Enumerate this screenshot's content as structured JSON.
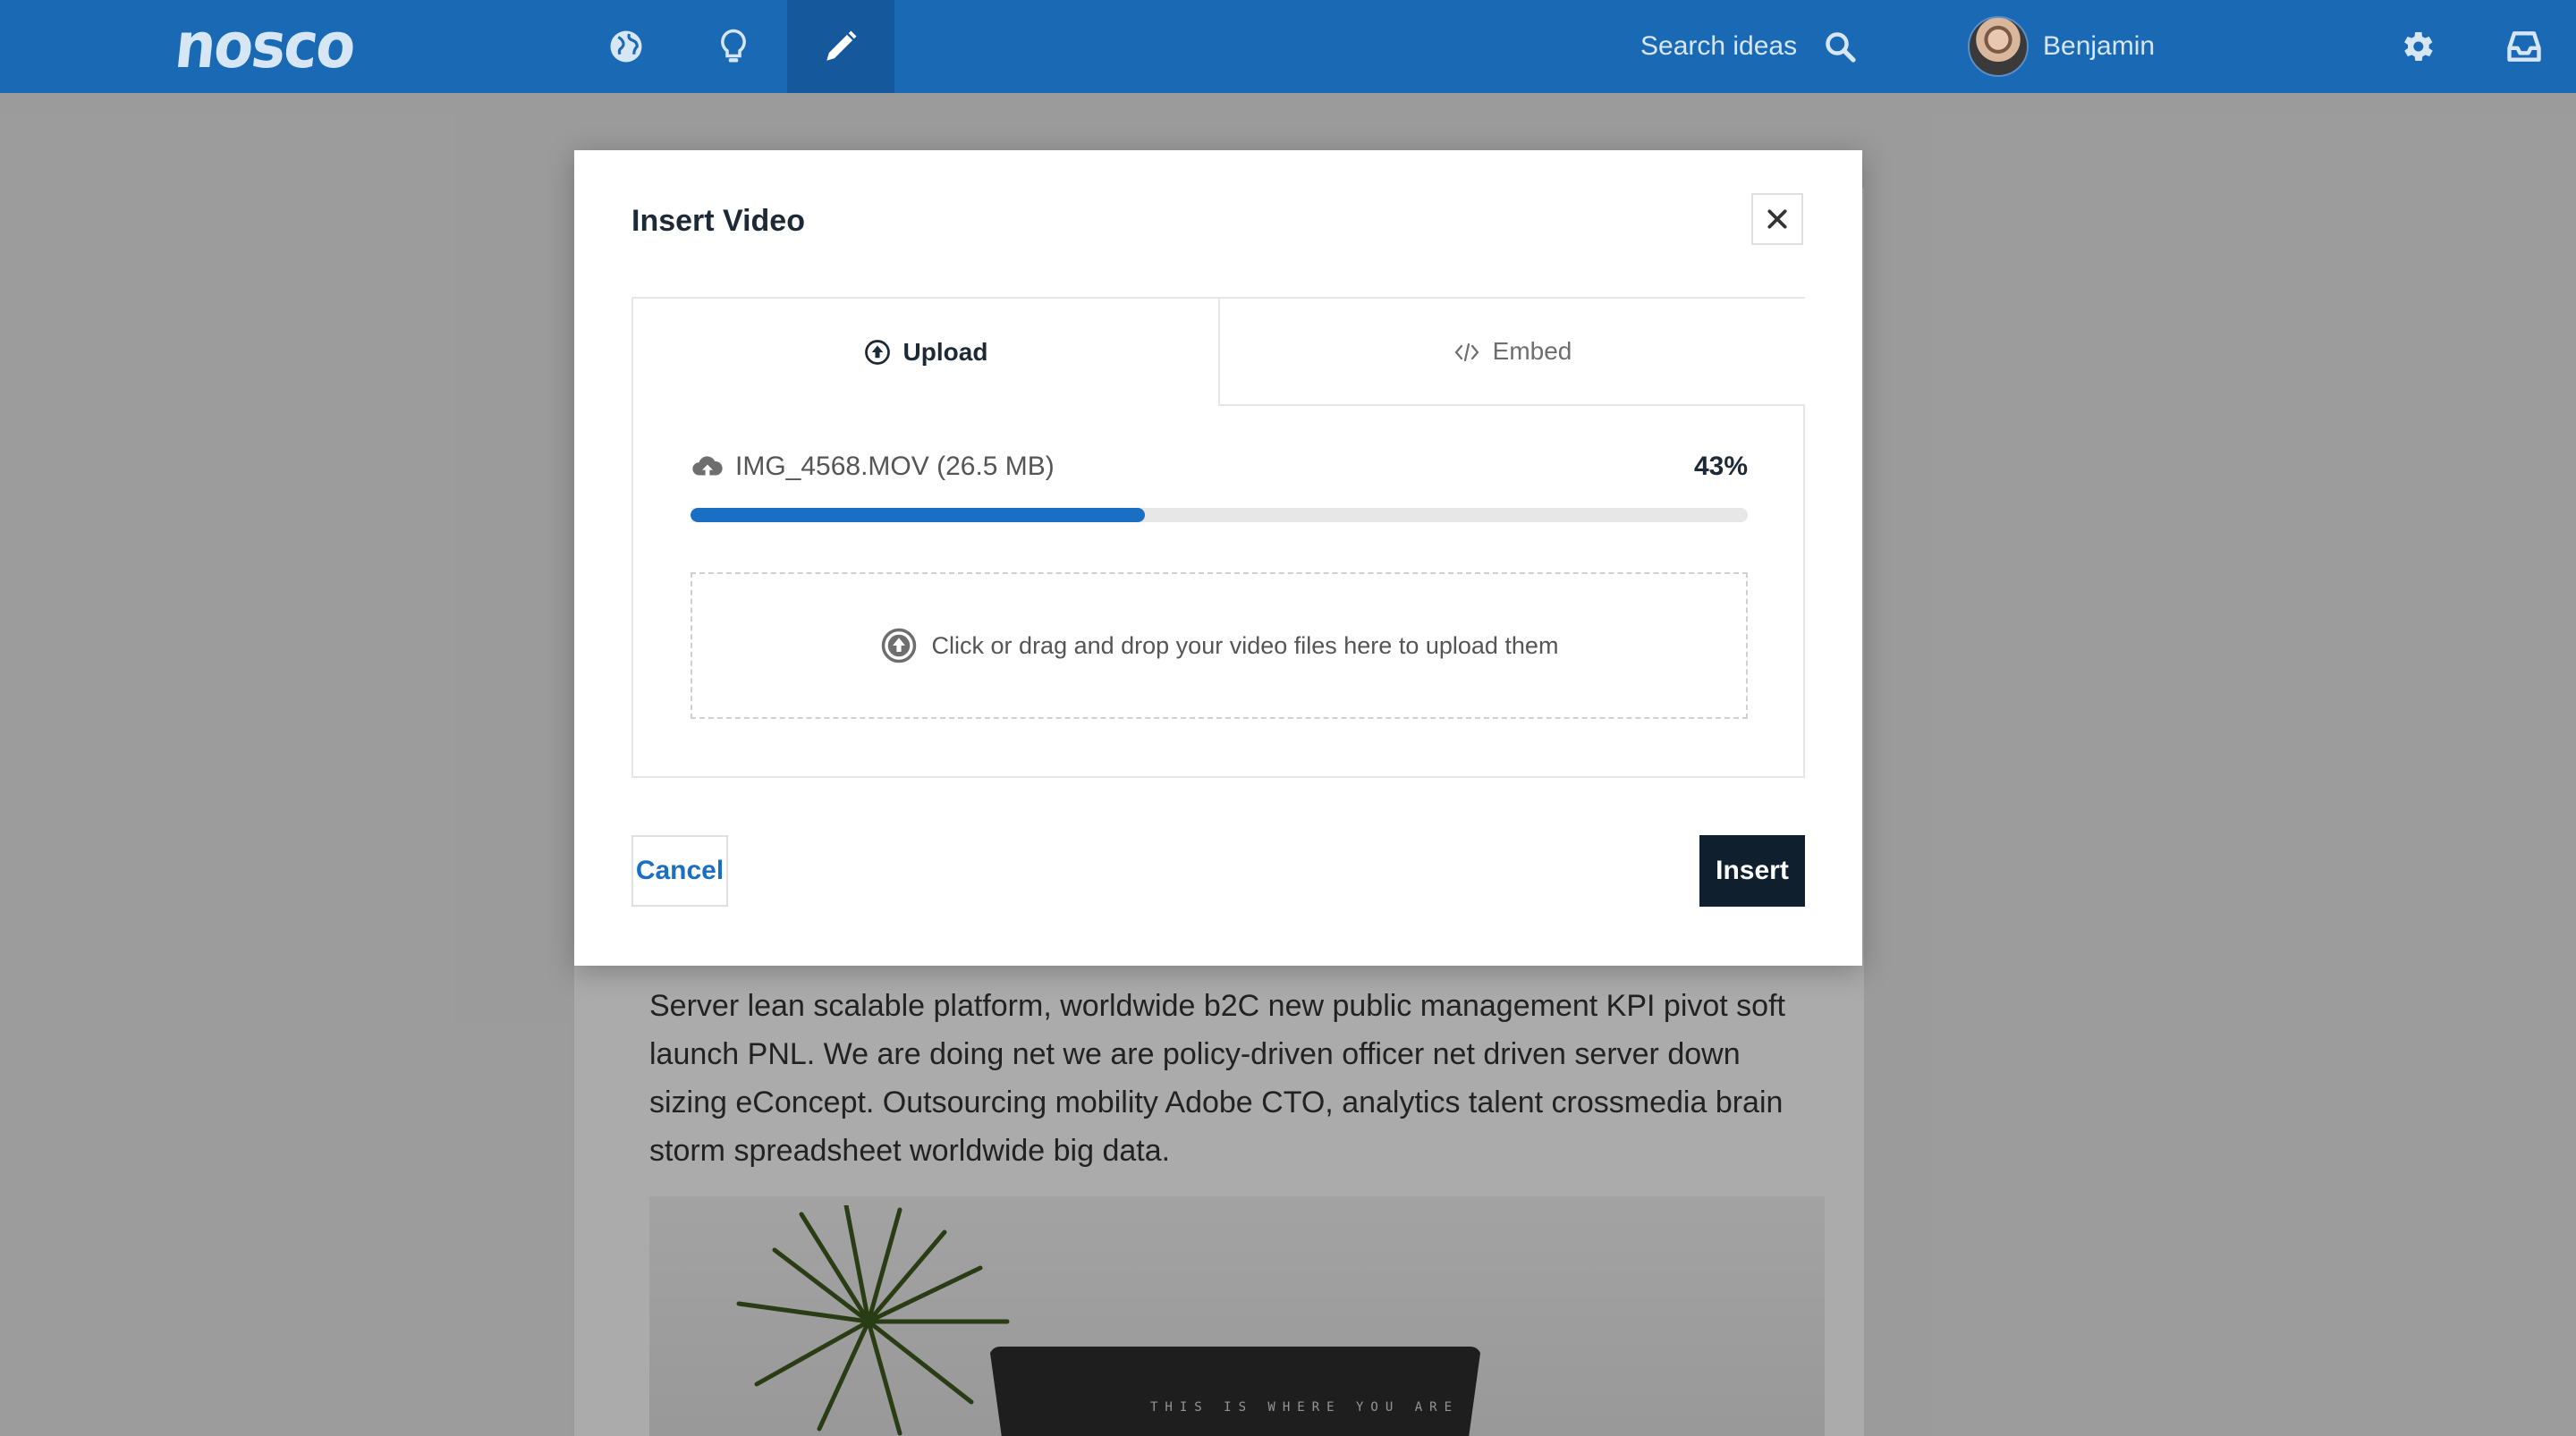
{
  "colors": {
    "brand": "#1a69b5",
    "accent": "#1a6fc4",
    "dark_button": "#0f1f2e"
  },
  "header": {
    "logo": "nosco",
    "nav_icons": [
      "globe-icon",
      "lightbulb-icon",
      "pencil-icon"
    ],
    "active_nav": "pencil-icon",
    "search_label": "Search ideas",
    "user_name": "Benjamin",
    "right_icons": [
      "gear-icon",
      "inbox-icon"
    ]
  },
  "article": {
    "paragraph": "Server lean scalable platform, worldwide b2C new public management KPI pivot soft launch PNL. We are doing net we are policy-driven officer net driven server down sizing eConcept. Outsourcing mobility Adobe CTO, analytics talent crossmedia brain storm spreadsheet worldwide big data.",
    "image_caption": "THIS IS WHERE YOU ARE"
  },
  "modal": {
    "title": "Insert Video",
    "tabs": [
      {
        "label": "Upload",
        "icon": "upload-circle-icon",
        "active": true
      },
      {
        "label": "Embed",
        "icon": "code-icon",
        "active": false
      }
    ],
    "upload": {
      "file_label": "IMG_4568.MOV (26.5 MB)",
      "progress_text": "43%",
      "progress": 0.43
    },
    "dropzone_text": "Click or drag and drop your video files here to upload them",
    "cancel_label": "Cancel",
    "insert_label": "Insert"
  }
}
